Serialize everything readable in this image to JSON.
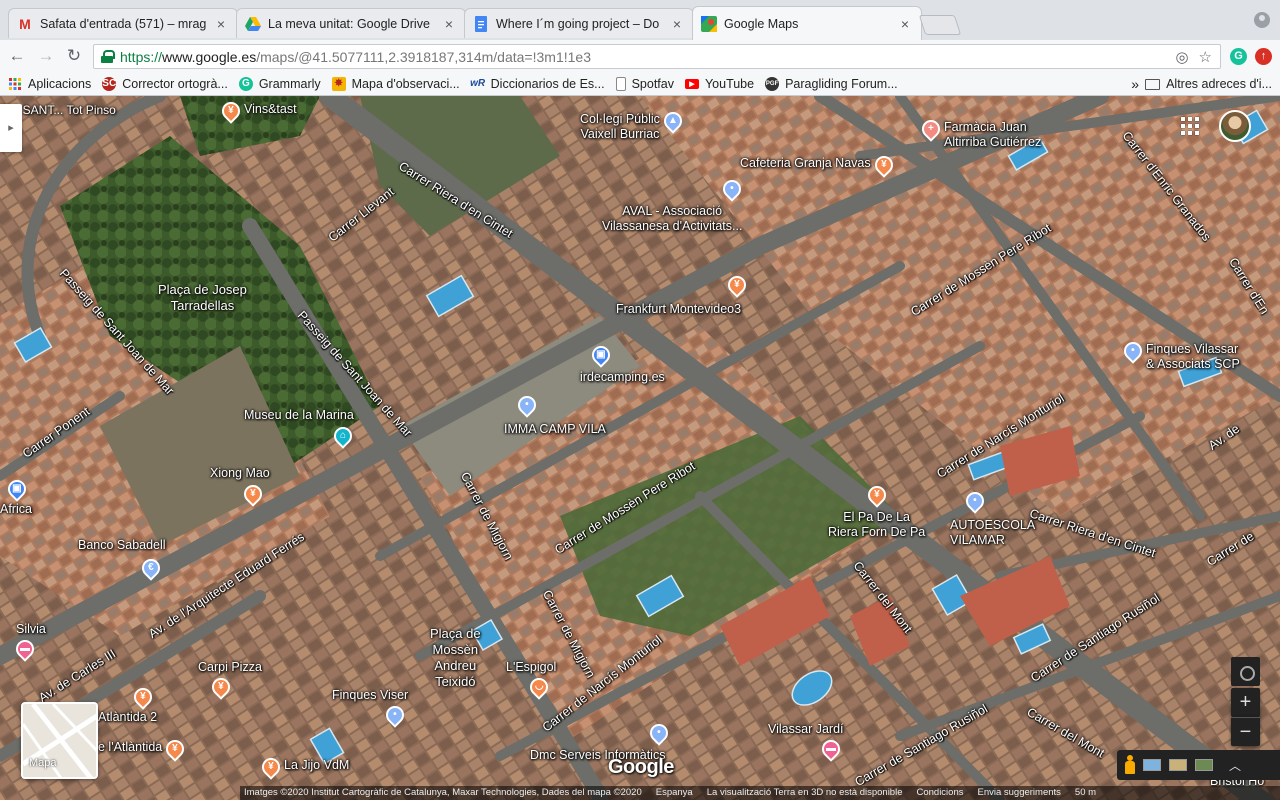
{
  "browser": {
    "tabs": [
      {
        "title": "Safata d'entrada (571) – mrag",
        "icon": "gmail-icon",
        "color": "#d93025"
      },
      {
        "title": "La meva unitat: Google Drive",
        "icon": "drive-icon",
        "color": "#1fa463"
      },
      {
        "title": "Where I´m going project – Do",
        "icon": "docs-icon",
        "color": "#4285f4"
      },
      {
        "title": "Google Maps",
        "icon": "maps-icon",
        "color": "#34a853"
      }
    ],
    "url": {
      "scheme": "https://",
      "host": "www.google.es",
      "path": "/maps/@41.5077111,2.3918187,314m/data=!3m1!1e3"
    },
    "bookmarks": [
      {
        "label": "Aplicacions",
        "icon": "apps-grid-icon",
        "color": "#d93025"
      },
      {
        "label": "Corrector ortogrà...",
        "icon": "corrector-icon",
        "color": "#b3261e"
      },
      {
        "label": "Grammarly",
        "icon": "grammarly-icon",
        "color": "#15c39a"
      },
      {
        "label": "Mapa d'observaci...",
        "icon": "observation-map-icon",
        "color": "#f4b400"
      },
      {
        "label": "Diccionarios de Es...",
        "icon": "wordreference-icon",
        "color": "#1a4a9c"
      },
      {
        "label": "Spotfav",
        "icon": "page-icon",
        "color": "#ffffff"
      },
      {
        "label": "YouTube",
        "icon": "youtube-icon",
        "color": "#ff0000"
      },
      {
        "label": "Paragliding Forum...",
        "icon": "forum-icon",
        "color": "#333333"
      }
    ],
    "bookmarks_overflow": "»",
    "other_bookmarks": "Altres adreces d'i..."
  },
  "map": {
    "pois": [
      {
        "name": "Vins&tast",
        "kind": "food",
        "color": "#f4894b"
      },
      {
        "name": "Col·legi Públic\nVaixell Burriac",
        "kind": "school",
        "color": "#8ab4f8"
      },
      {
        "name": "Farmàcia Juan\nAltirriba Gutiérrez",
        "kind": "pharmacy",
        "color": "#f28b82"
      },
      {
        "name": "Cafeteria Granja Navas",
        "kind": "food",
        "color": "#f4894b"
      },
      {
        "name": "AVAL - Associació\nVilassanesa d'Activitats...",
        "kind": "place",
        "color": "#8ab4f8"
      },
      {
        "name": "Frankfurt Montevideo3",
        "kind": "food",
        "color": "#f4894b"
      },
      {
        "name": "Finques Vilassar\n& Associats SCP",
        "kind": "place",
        "color": "#8ab4f8"
      },
      {
        "name": "irdecamping.es",
        "kind": "shop",
        "color": "#4285f4"
      },
      {
        "name": "IMMA CAMP VILA",
        "kind": "place",
        "color": "#8ab4f8"
      },
      {
        "name": "Museu de la Marina",
        "kind": "museum",
        "color": "#12b5cb"
      },
      {
        "name": "Xiong Mao",
        "kind": "food",
        "color": "#f4894b"
      },
      {
        "name": "Africa",
        "kind": "shop",
        "color": "#4285f4"
      },
      {
        "name": "Banco Sabadell",
        "kind": "bank",
        "color": "#8ab4f8"
      },
      {
        "name": "El Pa De La\nRiera Forn De Pa",
        "kind": "food",
        "color": "#f4894b"
      },
      {
        "name": "AUTOESCOLA\nVILAMAR",
        "kind": "place",
        "color": "#8ab4f8"
      },
      {
        "name": "Silvia",
        "kind": "hotel",
        "color": "#f06292"
      },
      {
        "name": "Carpi Pizza",
        "kind": "food",
        "color": "#f4894b"
      },
      {
        "name": "L'Espigol",
        "kind": "cafe",
        "color": "#f4894b"
      },
      {
        "name": "Finques Viser",
        "kind": "place",
        "color": "#8ab4f8"
      },
      {
        "name": "Atlàntida 2",
        "kind": "food",
        "color": "#f4894b"
      },
      {
        "name": "e l'Atlàntida",
        "kind": "food",
        "color": "#f4894b"
      },
      {
        "name": "La Jijo VdM",
        "kind": "food",
        "color": "#f4894b"
      },
      {
        "name": "Vilassar Jardí",
        "kind": "hotel",
        "color": "#f06292"
      },
      {
        "name": "Dmc Serveis Informàtics",
        "kind": "place",
        "color": "#8ab4f8"
      },
      {
        "name": "Bristol Ho",
        "kind": "hotel",
        "color": "#f06292"
      }
    ],
    "places": [
      {
        "name": "Plaça de Josep\nTarradellas"
      },
      {
        "name": "Plaça de\nMossèn\nAndreu\nTeixidó"
      },
      {
        "name": "RIA SANT... Tot Pinso"
      }
    ],
    "roads": [
      "Carrer Riera d'en Cintet",
      "Carrer Llevant",
      "Passeig de Sant Joan de Mar",
      "Passeig de Sant Joan de Mar",
      "Carrer de Mossèn Pere Ribot",
      "Carrer d'Enric Granados",
      "Carrer de Narcís Monturiol",
      "Carrer Ponent",
      "Carrer de Migjorn",
      "Carrer de Mossèn Pere Ribot",
      "Av. de l'Arquitecte Eduard Ferrés",
      "Carrer Riera d'en Cintet",
      "Carrer del Mont",
      "Carrer de Santiago Rusiñol",
      "Carrer de Migjorn",
      "Carrer de Narcís Monturiol",
      "Av. de Carles III",
      "Carrer del Mont",
      "Carrer de Santiago Rusiñol",
      "Carrer d'En",
      "Carrer de",
      "Av. de"
    ],
    "layers_label": "Mapa",
    "google_logo": "Google",
    "footer": [
      "Imatges ©2020 Institut Cartogràfic de Catalunya, Maxar Technologies, Dades del mapa ©2020",
      "Espanya",
      "La visualització Terra en 3D no està disponible",
      "Condicions",
      "Envia suggeriments",
      "50 m"
    ]
  }
}
